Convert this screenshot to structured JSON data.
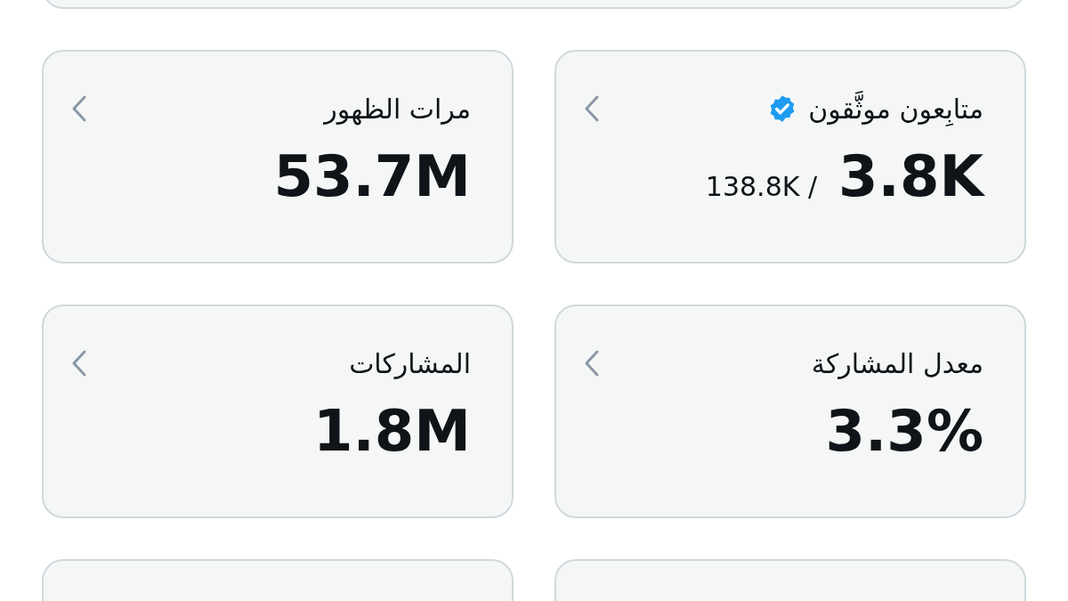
{
  "cards": [
    {
      "title": "متابِعون موثَّقون",
      "verified": true,
      "value": "3.8K",
      "secondary": "138.8K /"
    },
    {
      "title": "مرات الظهور",
      "verified": false,
      "value": "53.7M"
    },
    {
      "title": "معدل المشاركة",
      "verified": false,
      "value": "3.3%"
    },
    {
      "title": "المشاركات",
      "verified": false,
      "value": "1.8M"
    }
  ]
}
